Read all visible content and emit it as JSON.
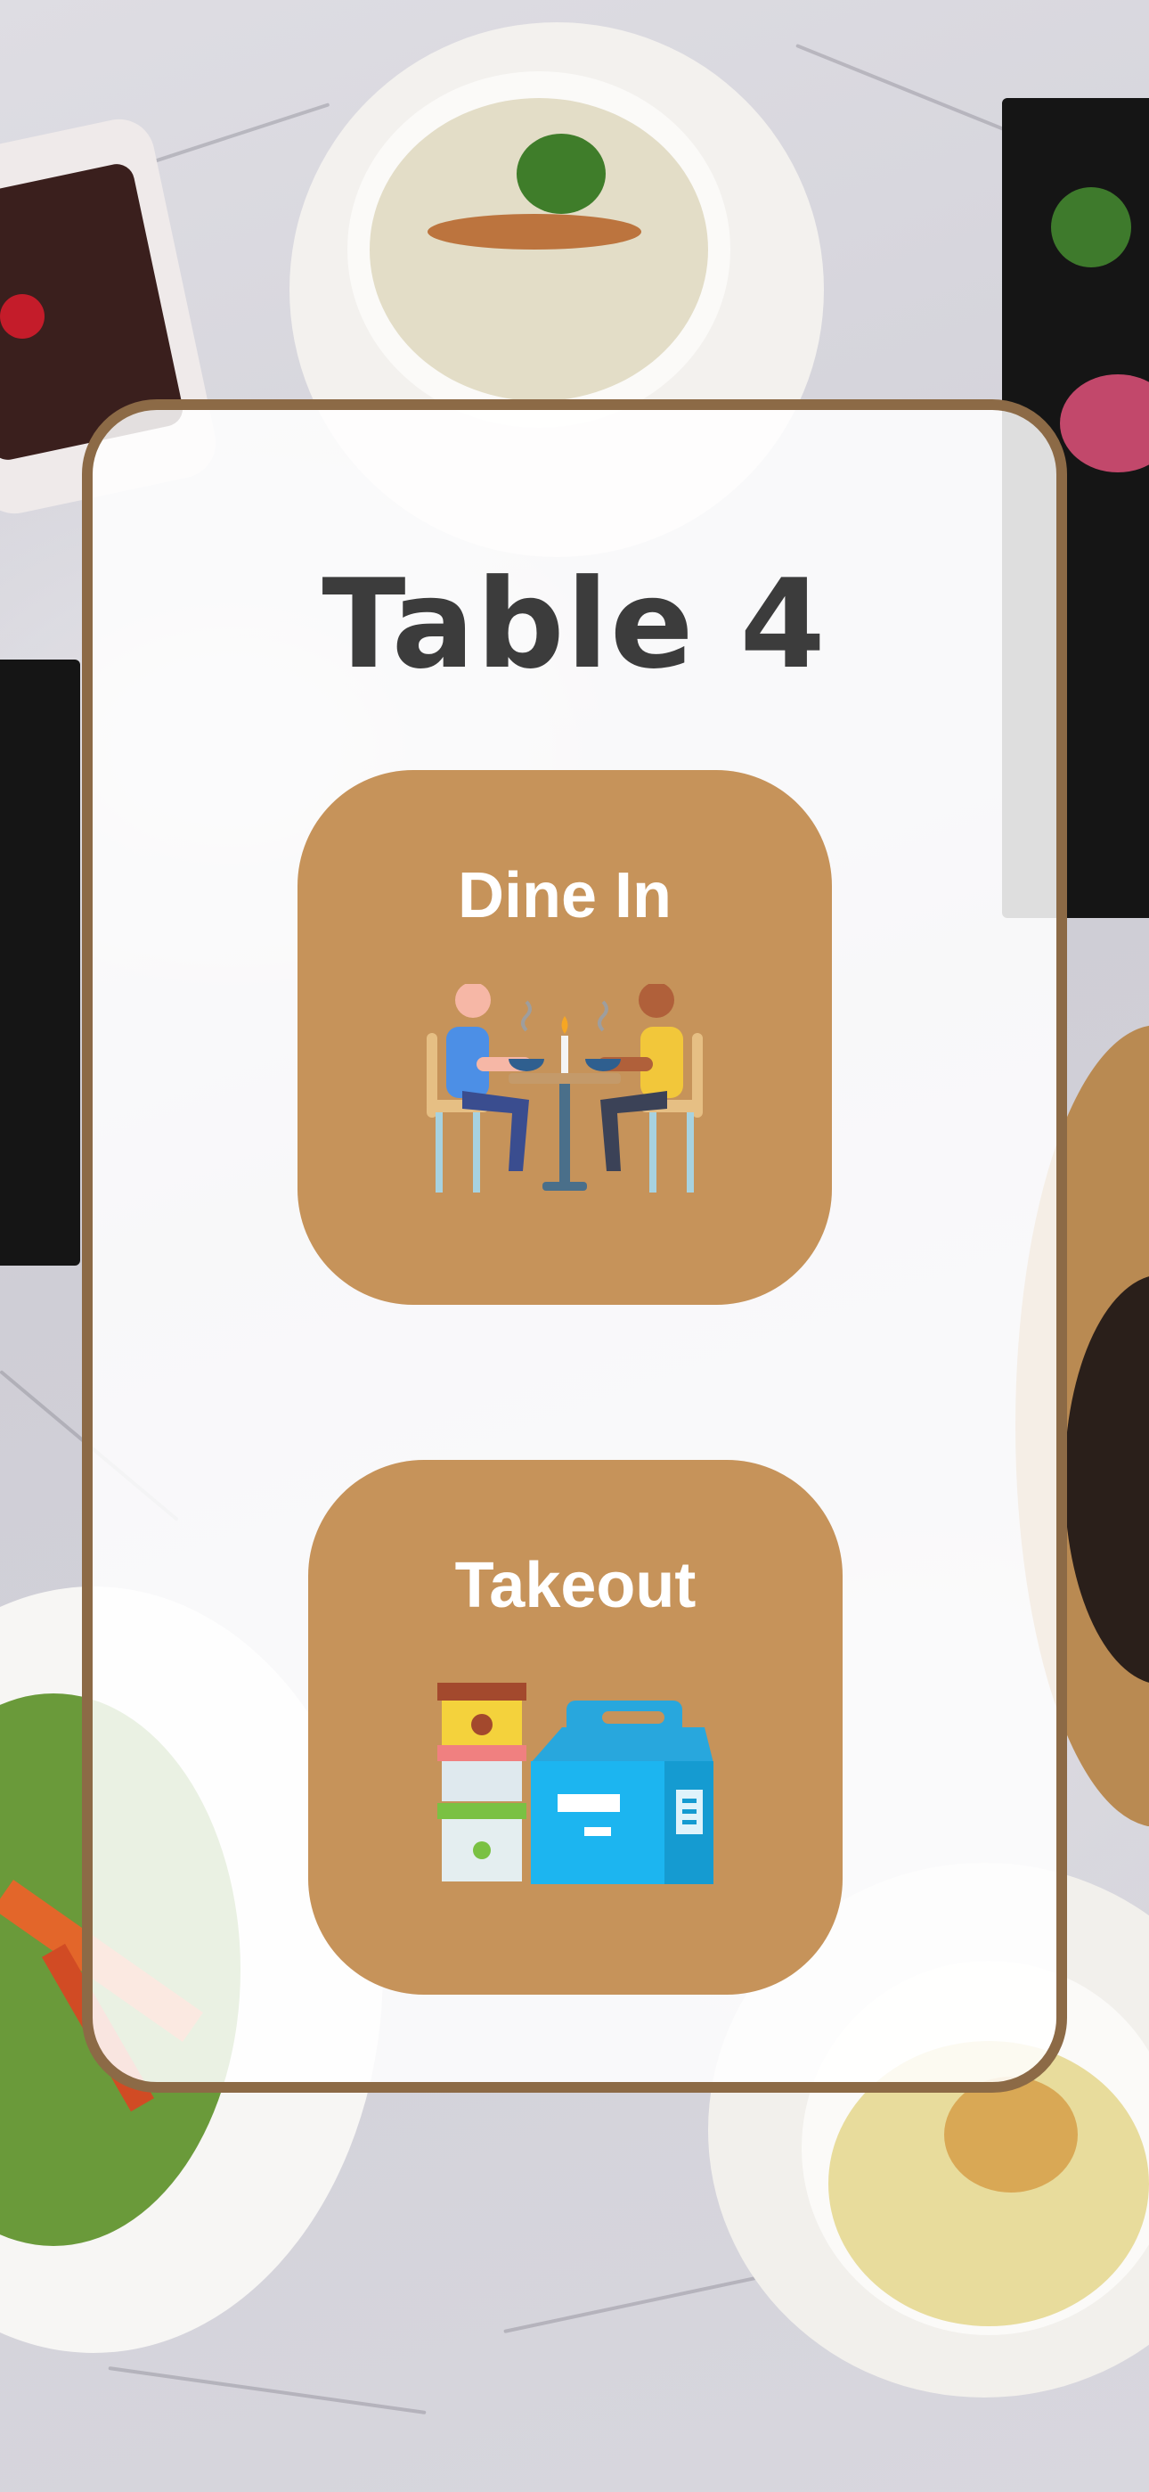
{
  "page": {
    "title": "Table 4"
  },
  "options": [
    {
      "id": "dine-in",
      "label": "Dine In",
      "icon": "dining-couple-icon"
    },
    {
      "id": "takeout",
      "label": "Takeout",
      "icon": "takeout-box-icon"
    }
  ],
  "colors": {
    "card_border": "#8c6a46",
    "card_background": "#ffffff",
    "option_background": "#c6935a",
    "title_text": "#3c3c3c",
    "option_text": "#ffffff"
  }
}
